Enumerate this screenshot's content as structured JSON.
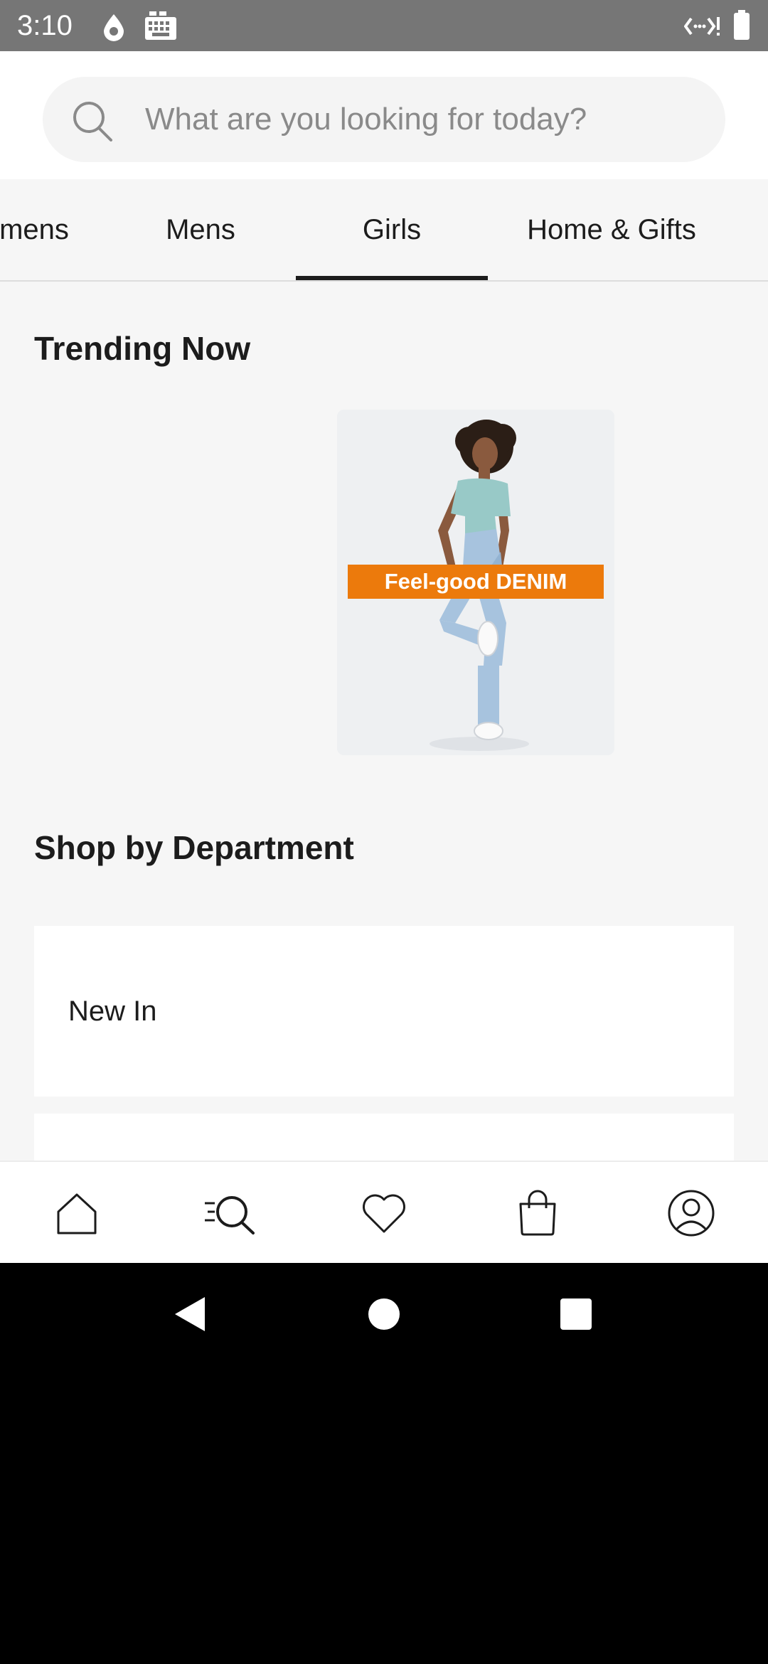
{
  "status_bar": {
    "time": "3:10",
    "icons": [
      "water-drop-icon",
      "keyboard-icon",
      "network-icon",
      "battery-icon"
    ]
  },
  "search": {
    "placeholder": "What are you looking for today?",
    "icon": "search-icon"
  },
  "tabs": [
    {
      "label": "mens",
      "selected": false
    },
    {
      "label": "Mens",
      "selected": false
    },
    {
      "label": "Girls",
      "selected": true
    },
    {
      "label": "Home & Gifts",
      "selected": false
    }
  ],
  "trending": {
    "title": "Trending Now",
    "promo_label": "Feel-good DENIM"
  },
  "departments": {
    "title": "Shop by Department",
    "items": [
      {
        "label": "New In"
      },
      {
        "label": ""
      }
    ]
  },
  "bottom_nav": {
    "items": [
      "home-icon",
      "browse-search-icon",
      "heart-icon",
      "shopping-bag-icon",
      "account-icon"
    ]
  },
  "colors": {
    "accent_orange": "#ec7a0c",
    "status_bar": "#767676",
    "page_background": "#f6f6f6"
  }
}
